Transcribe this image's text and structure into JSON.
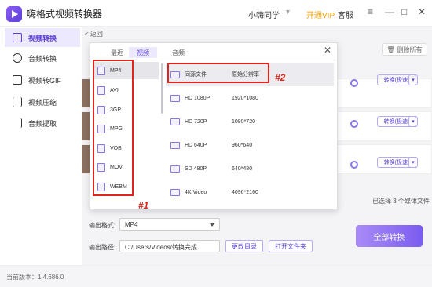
{
  "app": {
    "title": "嗨格式视频转换器",
    "user": "小嗨同学",
    "vip": "开通VIP",
    "service": "客服",
    "version": "当前版本：1.4.686.0"
  },
  "window_controls": {
    "menu": "≡",
    "minimize": "—",
    "maximize": "□",
    "close": "✕"
  },
  "sidebar": {
    "items": [
      {
        "label": "视频转换",
        "icon": "video-convert-icon"
      },
      {
        "label": "音频转换",
        "icon": "audio-icon"
      },
      {
        "label": "视频转GIF",
        "icon": "gif-icon"
      },
      {
        "label": "视频压缩",
        "icon": "compress-icon"
      },
      {
        "label": "音频提取",
        "icon": "extract-icon"
      }
    ]
  },
  "main": {
    "back": "< 返回",
    "delete_all": "删除所有",
    "convert_label": "转换(极速)",
    "dropdown_arrow": "▾",
    "selected_count": "已选择 3 个媒体文件",
    "output_format_label": "输出格式:",
    "output_format_value": "MP4",
    "output_path_label": "输出路径:",
    "output_path_value": "C:/Users/Videos/转换完成",
    "change_dir": "更改目录",
    "open_folder": "打开文件夹",
    "convert_all": "全部转换"
  },
  "popup": {
    "tabs": [
      "最近",
      "视频",
      "音频"
    ],
    "active_tab": 1,
    "close": "✕",
    "formats": [
      "MP4",
      "AVI",
      "3GP",
      "MPG",
      "VOB",
      "MOV",
      "WEBM"
    ],
    "resolutions": [
      {
        "name": "同源文件",
        "res": "原始分辨率"
      },
      {
        "name": "HD 1080P",
        "res": "1920*1080"
      },
      {
        "name": "HD 720P",
        "res": "1080*720"
      },
      {
        "name": "HD 640P",
        "res": "960*640"
      },
      {
        "name": "SD 480P",
        "res": "640*480"
      },
      {
        "name": "4K Video",
        "res": "4096*2160"
      }
    ],
    "annotations": {
      "label1": "#1",
      "label2": "#2"
    }
  }
}
